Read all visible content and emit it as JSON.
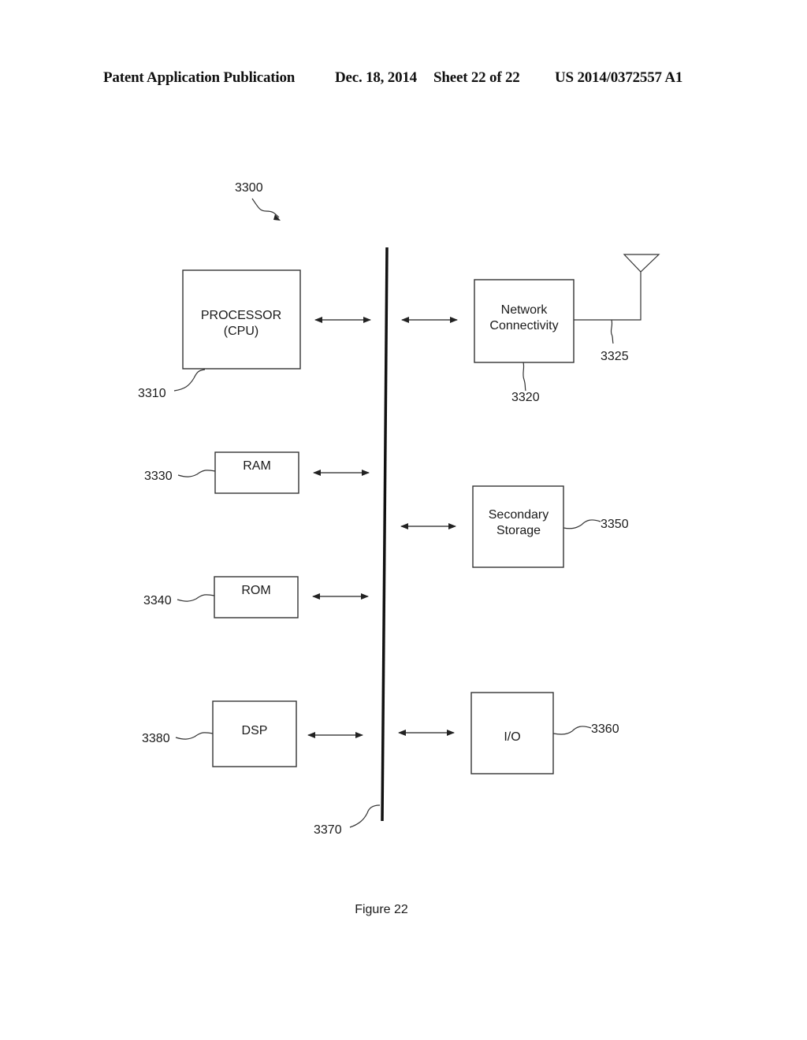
{
  "header": {
    "publication": "Patent Application Publication",
    "date": "Dec. 18, 2014",
    "sheet": "Sheet 22 of 22",
    "number": "US 2014/0372557 A1"
  },
  "diagram": {
    "system_ref": "3300",
    "bus_ref": "3370",
    "caption": "Figure 22",
    "blocks": {
      "processor": {
        "line1": "PROCESSOR",
        "line2": "(CPU)",
        "ref": "3310"
      },
      "network": {
        "line1": "Network",
        "line2": "Connectivity",
        "ref": "3320",
        "antenna_ref": "3325"
      },
      "ram": {
        "label": "RAM",
        "ref": "3330"
      },
      "rom": {
        "label": "ROM",
        "ref": "3340"
      },
      "storage": {
        "line1": "Secondary",
        "line2": "Storage",
        "ref": "3350"
      },
      "dsp": {
        "label": "DSP",
        "ref": "3380"
      },
      "io": {
        "label": "I/O",
        "ref": "3360"
      }
    }
  }
}
